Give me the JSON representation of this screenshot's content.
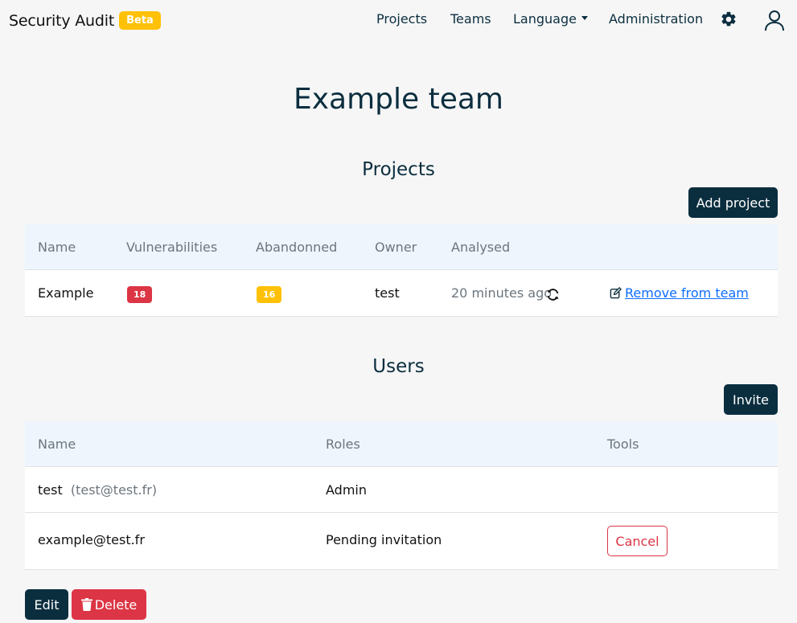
{
  "header": {
    "brand": "Security Audit",
    "beta": "Beta",
    "nav": {
      "projects": "Projects",
      "teams": "Teams",
      "language": "Language",
      "administration": "Administration"
    },
    "icons": [
      "gear-icon",
      "user-icon"
    ]
  },
  "page": {
    "title": "Example team"
  },
  "projects": {
    "title": "Projects",
    "add_label": "Add project",
    "columns": {
      "name": "Name",
      "vulnerabilities": "Vulnerabilities",
      "abandoned": "Abandonned",
      "owner": "Owner",
      "analysed": "Analysed"
    },
    "rows": [
      {
        "name": "Example",
        "vulnerabilities": "18",
        "abandoned": "16",
        "owner": "test",
        "analysed": "20 minutes ago",
        "action": "Remove from team"
      }
    ]
  },
  "users": {
    "title": "Users",
    "invite_label": "Invite",
    "columns": {
      "name": "Name",
      "roles": "Roles",
      "tools": "Tools"
    },
    "rows": [
      {
        "name": "test",
        "email": "(test@test.fr)",
        "role": "Admin"
      },
      {
        "name": "example@test.fr",
        "role": "Pending invitation",
        "tool": "Cancel"
      }
    ]
  },
  "footer": {
    "edit_label": "Edit",
    "delete_label": "Delete"
  },
  "colors": {
    "primary": "#0b2e3f",
    "danger": "#dc3545",
    "warning": "#ffc107",
    "link": "#0d6efd"
  }
}
